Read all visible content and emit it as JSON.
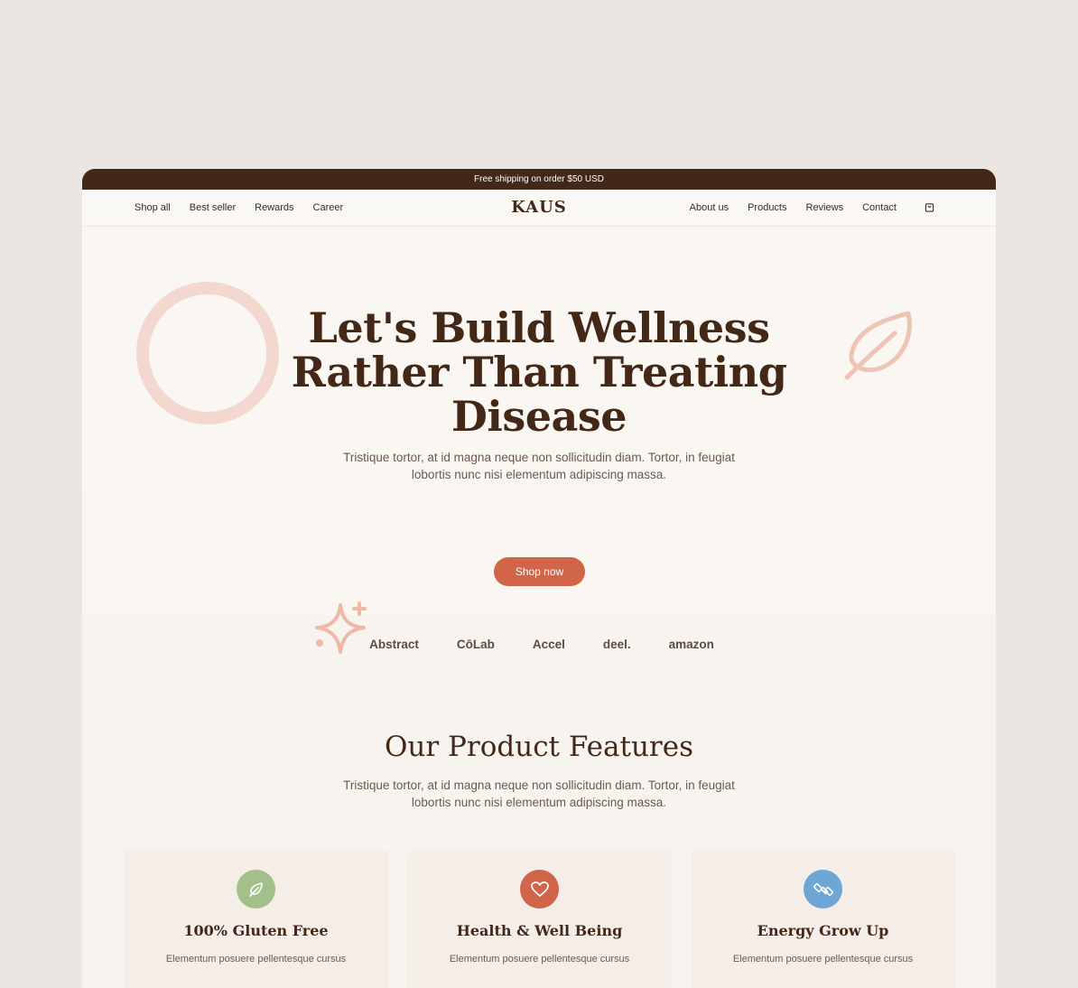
{
  "announcement": "Free shipping on order $50 USD",
  "nav": {
    "left": [
      "Shop all",
      "Best seller",
      "Rewards",
      "Career"
    ],
    "logo": "KAUS",
    "right": [
      "About us",
      "Products",
      "Reviews",
      "Contact"
    ],
    "cart_icon": "shopping-bag-icon"
  },
  "hero": {
    "title_lines": [
      "Let's Build Wellness",
      "Rather Than Treating",
      "Disease"
    ],
    "subtitle": "Tristique tortor, at id magna neque non sollicitudin diam. Tortor, in feugiat lobortis nunc nisi elementum adipiscing massa.",
    "cta": "Shop now"
  },
  "brands": [
    "Abstract",
    "CōLab",
    "Accel",
    "deel.",
    "amazon"
  ],
  "features": {
    "title": "Our Product Features",
    "subtitle": "Tristique tortor, at id magna neque non sollicitudin diam. Tortor, in feugiat lobortis nunc nisi elementum adipiscing massa.",
    "cards": [
      {
        "title": "100% Gluten Free",
        "desc": "Elementum posuere pellentesque cursus",
        "icon": "leaf-icon",
        "color": "#a3c08a"
      },
      {
        "title": "Health & Well Being",
        "desc": "Elementum posuere pellentesque cursus",
        "icon": "heart-icon",
        "color": "#d1654a"
      },
      {
        "title": "Energy Grow Up",
        "desc": "Elementum posuere pellentesque cursus",
        "icon": "dumbbell-icon",
        "color": "#6ea6d6"
      }
    ]
  },
  "colors": {
    "brand_dark": "#432818",
    "accent": "#d1654a",
    "decor": "#efc4b6"
  }
}
